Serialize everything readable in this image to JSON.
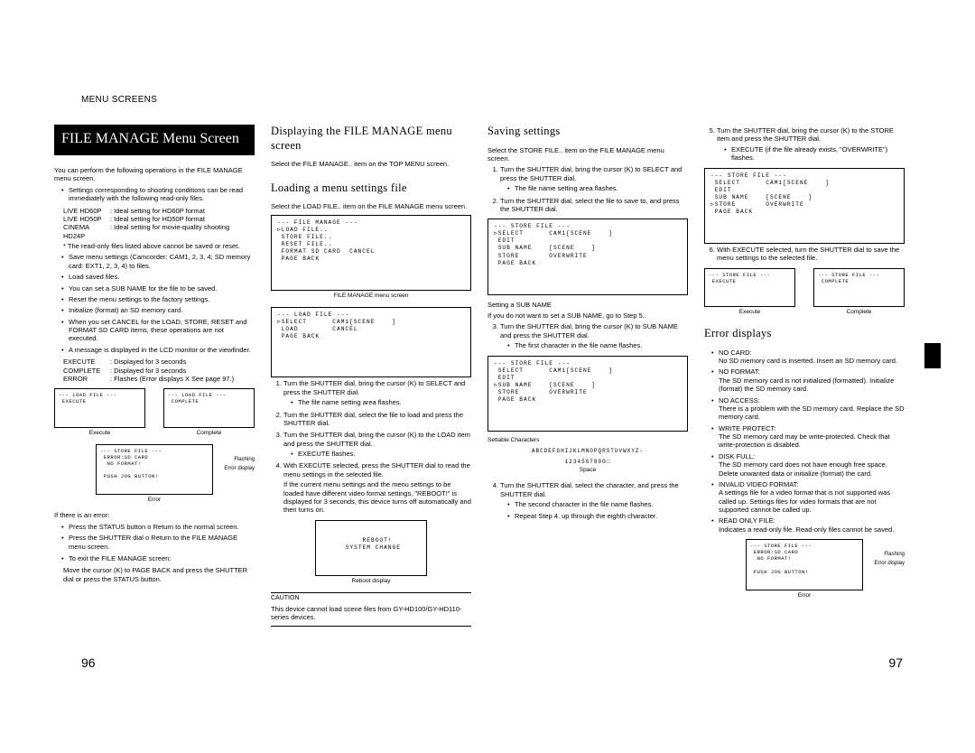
{
  "header": {
    "section": "MENU SCREENS"
  },
  "col1": {
    "title": "FILE MANAGE Menu Screen",
    "intro": "You can perform the following operations in the FILE MANAGE menu screen.",
    "bullets1": [
      "Settings corresponding to shooting conditions can be read immediately with the following read-only files."
    ],
    "formats": [
      {
        "name": "LIVE HD60P",
        "desc": ": Ideal setting for HD60P format"
      },
      {
        "name": "LIVE HD50P",
        "desc": ": Ideal setting for HD50P format"
      },
      {
        "name": "CINEMA HD24P",
        "desc": ": Ideal setting for movie-quality shooting"
      }
    ],
    "note_ro": "* The read-only files listed above cannot be saved or reset.",
    "bullets2": [
      "Save menu settings (Camcorder: CAM1, 2, 3, 4; SD memory card: EXT1, 2, 3, 4) to files.",
      "Load saved files.",
      "You can set a SUB NAME for the file to be saved.",
      "Reset the menu settings to the factory settings.",
      "Initialize (format) an SD memory card.",
      "When you set CANCEL for the LOAD, STORE, RESET and FORMAT SD CARD items, these operations are not executed.",
      "A message is displayed in the LCD monitor or the viewfinder."
    ],
    "msgs": [
      {
        "k": "EXECUTE",
        "v": ": Displayed for 3 seconds"
      },
      {
        "k": "COMPLETE",
        "v": ": Displayed for 3 seconds"
      },
      {
        "k": "ERROR",
        "v": ": Flashes (Error displays X  See page 97.)"
      }
    ],
    "diag": {
      "exec_hdr": "--- LOAD FILE ---",
      "exec_body": " EXECUTE",
      "exec_label": "Execute",
      "comp_hdr": "--- LOAD FILE ---",
      "comp_body": " COMPLETE",
      "comp_label": "Complete"
    },
    "err_hdr": "--- STORE FILE ---",
    "err_line1": " ERROR:SD CARD",
    "err_line2": "  NO FORMAT!",
    "err_line3": " PUSH JOG BUTTON!",
    "err_anno1": "Flashing",
    "err_anno2": "Error display",
    "err_label": "Error",
    "if_error_title": "If there is an error:",
    "if_error": [
      "Press the STATUS button o Return to the normal screen.",
      "Press the SHUTTER dial o Return to the FILE MANAGE menu screen."
    ],
    "exit_title": "To exit the FILE MANAGE screen:",
    "exit_body": "Move the cursor (K) to PAGE BACK and press the SHUTTER dial or press the STATUS button."
  },
  "col2": {
    "h1": "Displaying the FILE MANAGE menu screen",
    "p1": "Select the FILE MANAGE.. item on the TOP MENU screen.",
    "h2": "Loading a menu settings file",
    "p2": "Select the LOAD FILE.. item on the FILE MANAGE menu screen.",
    "fm_hdr": "--- FILE MANAGE ---",
    "fm_body": "▷LOAD FILE..\n STORE FILE..\n RESET FILE..\n FORMAT SD CARD  CANCEL\n PAGE BACK",
    "fm_caption": "FILE MANAGE menu screen",
    "lf_hdr": "--- LOAD FILE ---",
    "lf_body": "▷SELECT      CAM1[SCENE    ]\n LOAD        CANCEL\n PAGE BACK",
    "steps": [
      "Turn the SHUTTER dial, bring the cursor (K) to SELECT and press the SHUTTER dial.",
      "Turn the SHUTTER dial, select the file to load and press the SHUTTER dial.",
      "Turn the SHUTTER dial, bring the cursor (K) to the LOAD item and press the SHUTTER dial.",
      "With EXECUTE selected, press the SHUTTER dial to read the menu settings in the selected file."
    ],
    "step1_sub": "The file name setting area flashes.",
    "step3_sub": "EXECUTE flashes.",
    "step4_extra": "If the current menu settings and the menu settings to be loaded have different video format settings, \"REBOOT!\" is displayed for 3 seconds, this device turns off automatically and then turns on.",
    "reboot_body": "   REBOOT!\n SYSTEM CHANGE",
    "reboot_caption": "Reboot display",
    "caution_title": "CAUTION",
    "caution_body": "This device cannot load scene files from GY-HD100/GY-HD110-series devices."
  },
  "col3": {
    "h1": "Saving settings",
    "p1": "Select the STORE FILE.. item on the FILE MANAGE menu screen.",
    "steps12": [
      "Turn the SHUTTER dial, bring the cursor (K) to SELECT and press the SHUTTER dial.",
      "Turn the SHUTTER dial, select the file to save to, and press the SHUTTER dial."
    ],
    "step1_sub": "The file name setting area flashes.",
    "sf_hdr": "--- STORE FILE ---",
    "sf_body": "▷SELECT      CAM1[SCENE    ]\n EDIT\n SUB NAME    [SCENE    ]\n STORE       OVERWRITE\n PAGE BACK",
    "subname_title": "Setting a SUB NAME",
    "subname_note": "If you do not want to set a SUB NAME, go to Step 5..",
    "step3": "Turn the SHUTTER dial, bring the cursor (K) to SUB NAME and press the SHUTTER dial.",
    "step3_sub": "The first character in the file name flashes.",
    "sf2_body": " SELECT      CAM1[SCENE    ]\n EDIT\n▷SUB NAME    [SCENE    ]\n STORE       OVERWRITE\n PAGE BACK",
    "charset_title": "Settable Characters",
    "charset1": "ABCDEFGHIJKLMNOPQRSTUVWXYZ-",
    "charset2": "1234567890□",
    "charset_caption": "Space",
    "step4": "Turn the SHUTTER dial, select the character, and press the SHUTTER dial.",
    "step4_subs": [
      "The second character in the file name flashes.",
      "Repeat Step 4. up through the eighth character."
    ]
  },
  "col4": {
    "step5": "Turn the SHUTTER dial, bring the cursor (K) to the STORE item and press the SHUTTER dial.",
    "step5_sub": "EXECUTE (if the file already exists, \"OVERWRITE\") flashes.",
    "sf3_hdr": "--- STORE FILE ---",
    "sf3_body": " SELECT      CAM1[SCENE    ]\n EDIT\n SUB NAME    [SCENE    ]\n▷STORE       OVERWRITE\n PAGE BACK",
    "step6": "With EXECUTE selected, turn the SHUTTER dial to save the menu settings to the selected file.",
    "diag": {
      "exec_hdr": "--- STORE FILE ---",
      "exec_body": " EXECUTE",
      "exec_label": "Execute",
      "comp_hdr": "--- STORE FILE ---",
      "comp_body": " COMPLETE",
      "comp_label": "Complete"
    },
    "h_err": "Error displays",
    "errors": [
      {
        "k": "NO CARD:",
        "v": "No SD memory card is inserted. Insert an SD memory card."
      },
      {
        "k": "NO FORMAT:",
        "v": "The SD memory card is not initialized (formatted). Initialize (format) the SD memory card."
      },
      {
        "k": "NO ACCESS:",
        "v": "There is a problem with the SD memory card. Replace the SD memory card."
      },
      {
        "k": "WRITE PROTECT:",
        "v": "The SD memory card may be write-protected. Check that write-protection is disabled."
      },
      {
        "k": "DISK FULL:",
        "v": "The SD memory card does not have enough free space. Delete unwanted data or initialize (format) the card."
      },
      {
        "k": "INVALID VIDEO FORMAT:",
        "v": "A settings file for a video format that is not supported was called up. Settings files for video formats that are not supported cannot be called up."
      },
      {
        "k": "READ ONLY FILE:",
        "v": "Indicates a read-only file. Read-only files cannot be saved."
      }
    ],
    "err_hdr": "--- STORE FILE ---",
    "err_line1": " ERROR:SD CARD",
    "err_line2": "  NO FORMAT!",
    "err_line3": " PUSH JOG BUTTON!",
    "err_anno1": "Flashing",
    "err_anno2": "Error display",
    "err_label": "Error"
  },
  "pagenums": {
    "left": "96",
    "right": "97"
  }
}
